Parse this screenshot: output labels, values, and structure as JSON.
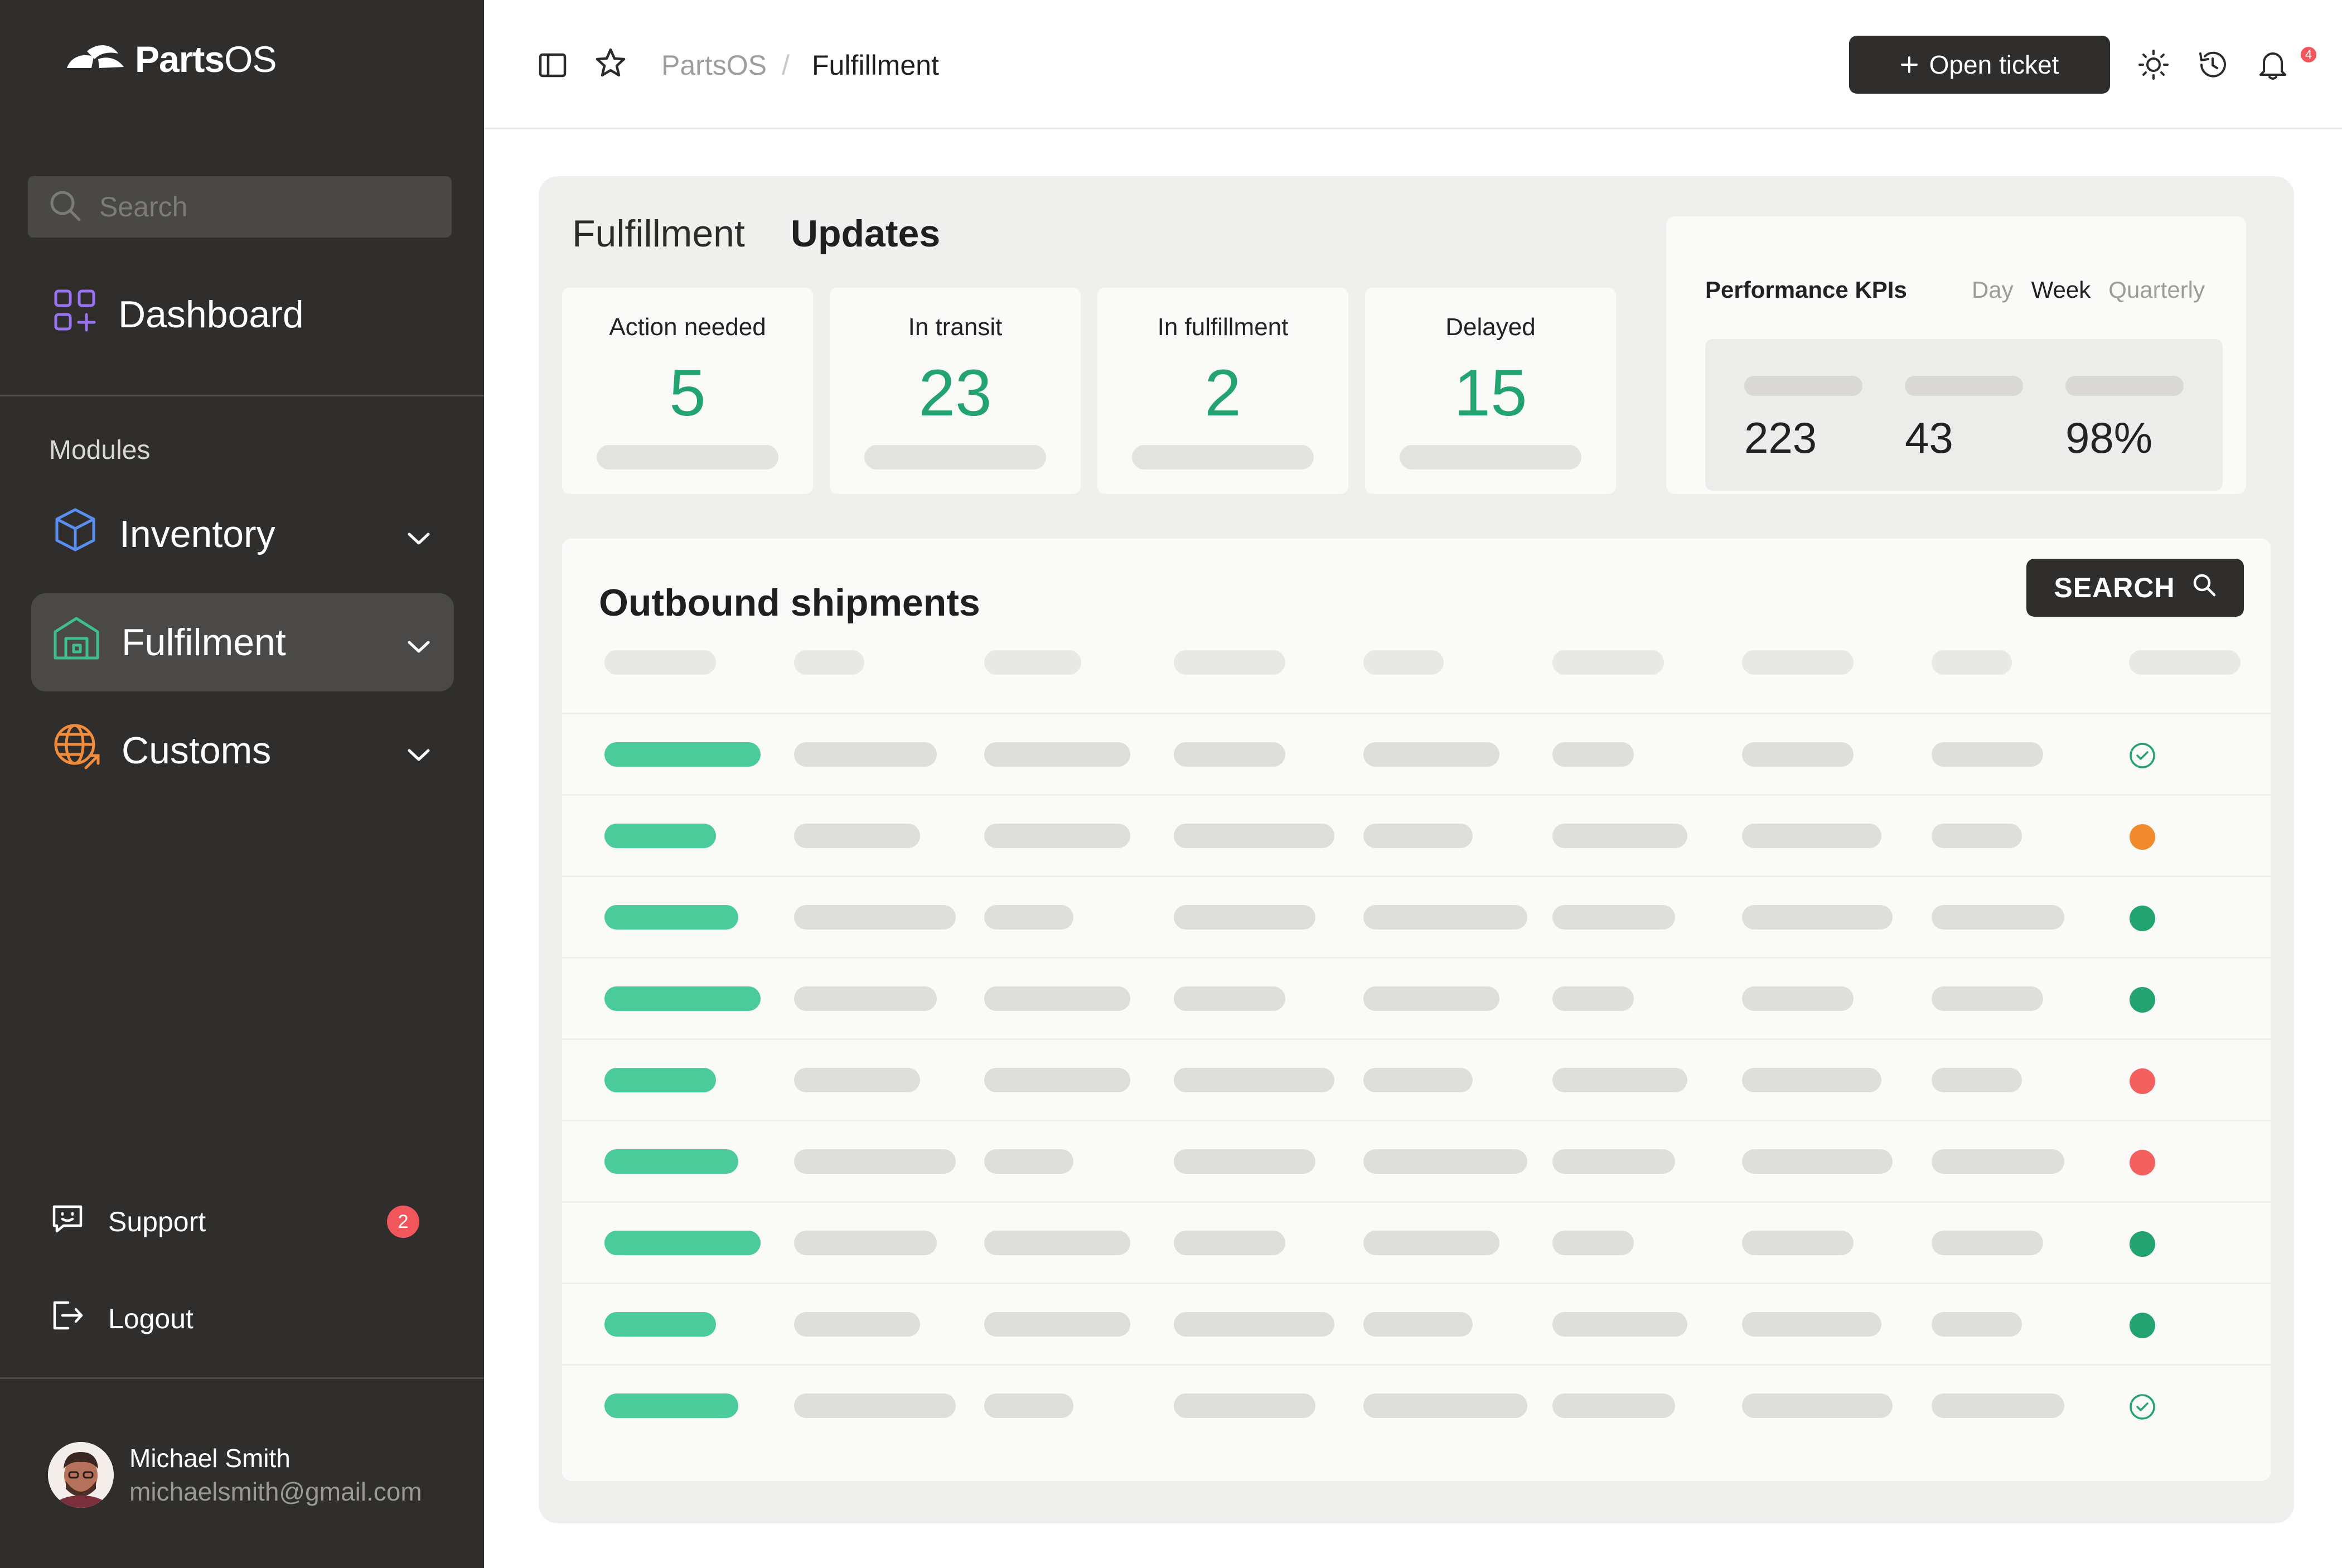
{
  "app": {
    "name_bold": "Parts",
    "name_light": "OS"
  },
  "sidebar": {
    "search_placeholder": "Search",
    "dashboard_label": "Dashboard",
    "modules_label": "Modules",
    "modules": [
      {
        "label": "Inventory",
        "icon": "box-icon",
        "color": "#5a8ff0"
      },
      {
        "label": "Fulfilment",
        "icon": "warehouse-icon",
        "color": "#3fbf8f",
        "active": true
      },
      {
        "label": "Customs",
        "icon": "globe-icon",
        "color": "#f08c3c"
      }
    ],
    "support_label": "Support",
    "support_badge": "2",
    "logout_label": "Logout"
  },
  "user": {
    "name": "Michael Smith",
    "email": "michaelsmith@gmail.com"
  },
  "topbar": {
    "breadcrumb_root": "PartsOS",
    "breadcrumb_sep": "/",
    "breadcrumb_current": "Fulfillment",
    "open_ticket_label": "Open ticket",
    "notification_count": "4"
  },
  "content": {
    "tabs": [
      "Fulfillment",
      "Updates"
    ],
    "stats": [
      {
        "title": "Action needed",
        "value": "5"
      },
      {
        "title": "In transit",
        "value": "23"
      },
      {
        "title": "In fulfillment",
        "value": "2"
      },
      {
        "title": "Delayed",
        "value": "15"
      }
    ],
    "kpi": {
      "title": "Performance KPIs",
      "periods": [
        "Day",
        "Week",
        "Quarterly"
      ],
      "selected_period": "Week",
      "values": [
        "223",
        "43",
        "98%"
      ]
    },
    "shipments": {
      "title": "Outbound shipments",
      "search_label": "SEARCH",
      "row_statuses": [
        "check",
        "orange",
        "green",
        "green",
        "red",
        "red",
        "green",
        "green",
        "check"
      ]
    }
  },
  "colors": {
    "accent_green": "#22a36f",
    "status_green": "#22a36f",
    "status_orange": "#f08a2c",
    "status_red": "#f4605e",
    "sidebar_bg": "#2f2e2c"
  }
}
